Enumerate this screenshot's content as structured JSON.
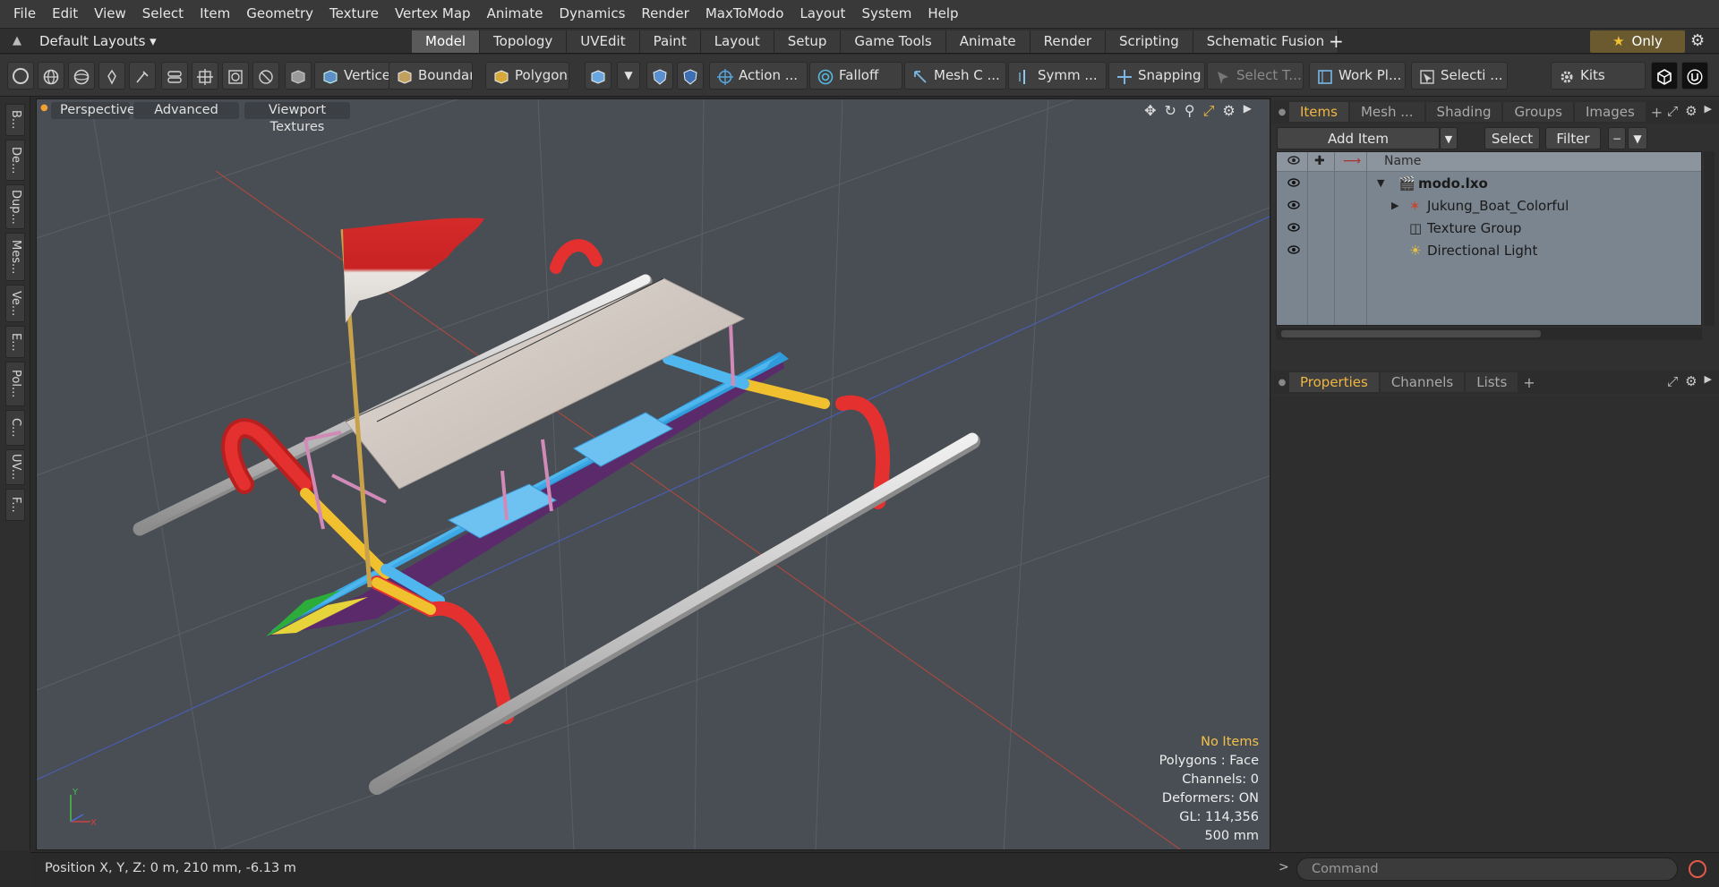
{
  "menu": [
    "File",
    "Edit",
    "View",
    "Select",
    "Item",
    "Geometry",
    "Texture",
    "Vertex Map",
    "Animate",
    "Dynamics",
    "Render",
    "MaxToModo",
    "Layout",
    "System",
    "Help"
  ],
  "layout_selector": "Default Layouts ▾",
  "layout_tabs": [
    "Model",
    "Topology",
    "UVEdit",
    "Paint",
    "Layout",
    "Setup",
    "Game Tools",
    "Animate",
    "Render",
    "Scripting",
    "Schematic Fusion"
  ],
  "active_layout_tab": "Model",
  "only_label": "Only",
  "toolbar": {
    "vertices": "Vertices",
    "boundary": "Boundary",
    "polygons": "Polygons",
    "action": "Action ...",
    "falloff": "Falloff",
    "mesh": "Mesh C ...",
    "symmetry": "Symm ...",
    "snapping": "Snapping",
    "select_tool": "Select T...",
    "work_plane": "Work Pl...",
    "selection": "Selecti ...",
    "kits": "Kits"
  },
  "left_tabs": [
    "B...",
    "De...",
    "Dup...",
    "Mes...",
    "Ve...",
    "E...",
    "Pol...",
    "C...",
    "UV...",
    "F..."
  ],
  "viewport": {
    "perspective": "Perspective",
    "advanced": "Advanced",
    "viewport_textures": "Viewport Textures",
    "stats": {
      "selection": "No Items",
      "polygons": "Polygons : Face",
      "channels": "Channels: 0",
      "deformers": "Deformers: ON",
      "gl": "GL: 114,356",
      "unit": "500 mm"
    }
  },
  "items_panel": {
    "tabs": [
      "Items",
      "Mesh ...",
      "Shading",
      "Groups",
      "Images"
    ],
    "active_tab": "Items",
    "add_item": "Add Item",
    "select": "Select",
    "filter": "Filter",
    "name_header": "Name",
    "rows": [
      {
        "label": "modo.lxo",
        "bold": true
      },
      {
        "label": "Jukung_Boat_Colorful"
      },
      {
        "label": "Texture Group"
      },
      {
        "label": "Directional Light"
      }
    ]
  },
  "properties_panel": {
    "tabs": [
      "Properties",
      "Channels",
      "Lists"
    ],
    "active_tab": "Properties"
  },
  "status": {
    "position": "Position X, Y, Z:  0 m, 210 mm, -6.13 m"
  },
  "command": {
    "placeholder": "Command"
  },
  "colors": {
    "accent": "#f0b640",
    "viewport_bg": "#494e55",
    "boat_hull": "#3ea8e6",
    "outrigger": "#e02828"
  }
}
